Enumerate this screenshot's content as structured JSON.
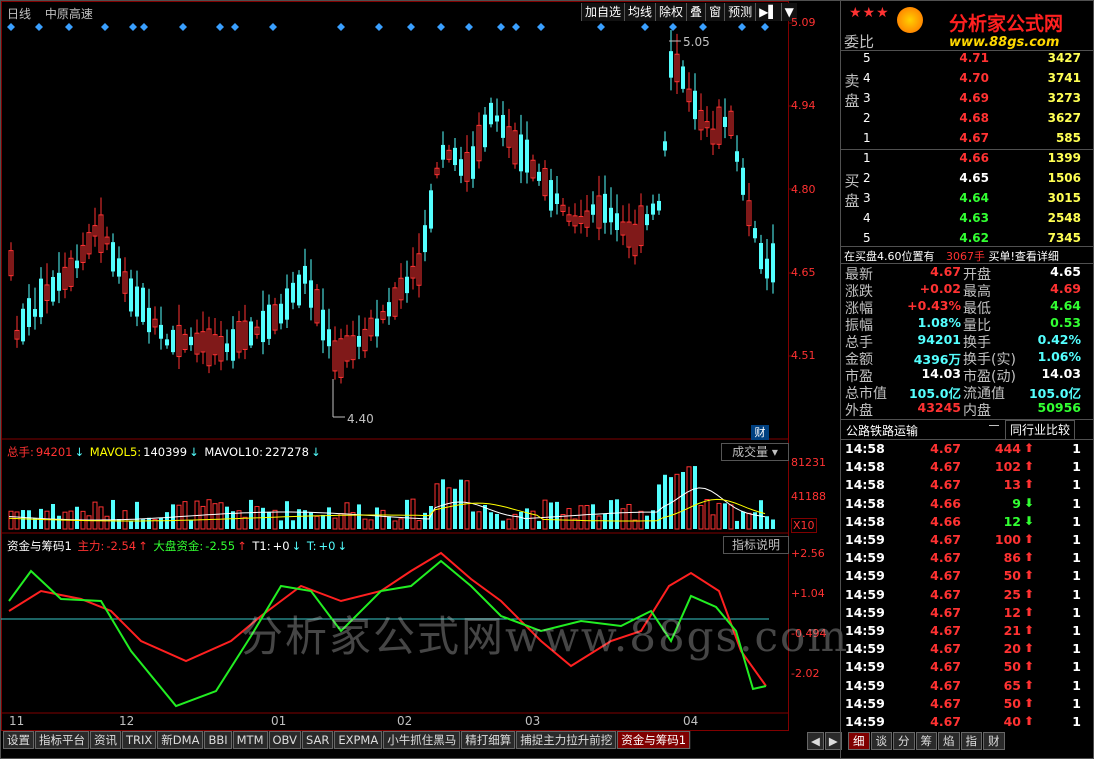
{
  "header": {
    "period": "日线",
    "stock_name": "中原高速"
  },
  "toolbar": [
    "加自选",
    "均线",
    "除权",
    "叠",
    "窗",
    "预测"
  ],
  "toolbar_icons": [
    "arrow-right-icon",
    "dropdown-icon"
  ],
  "price_axis": [
    "5.09",
    "4.94",
    "4.80",
    "4.65",
    "4.51"
  ],
  "price_annotations": {
    "high": "5.05",
    "low": "4.40"
  },
  "finance_badge": "财",
  "volume": {
    "label": "总手:",
    "value": "94201",
    "ma5_label": "MAVOL5:",
    "ma5": "140399",
    "ma10_label": "MAVOL10:",
    "ma10": "227278",
    "axis": [
      "81231",
      "41188"
    ],
    "unit": "X10",
    "dropdown": "成交量"
  },
  "indicator": {
    "name": "资金与筹码1",
    "main_label": "主力:",
    "main": "-2.54",
    "market_label": "大盘资金:",
    "market": "-2.55",
    "t1_label": "T1:",
    "t1": "+0",
    "t_label": "T:",
    "t": "+0",
    "button": "指标说明",
    "axis": [
      "+2.56",
      "+1.04",
      "-0.494",
      "-2.02"
    ]
  },
  "x_axis": [
    "11",
    "12",
    "01",
    "02",
    "03",
    "04"
  ],
  "watermark": "分析家公式网www.88gs.com",
  "bottom_tabs": [
    "设置",
    "指标平台",
    "资讯",
    "TRIX",
    "新DMA",
    "BBI",
    "MTM",
    "OBV",
    "SAR",
    "EXPMA",
    "小牛抓住黑马",
    "精打细算",
    "捕捉主力拉升前挖",
    "资金与筹码1"
  ],
  "bottom_tabs_active": 13,
  "logo": {
    "title": "分析家公式网",
    "url": "www.88gs.com"
  },
  "order_book": {
    "header": "委比",
    "sell_label": "卖盘",
    "buy_label": "买盘",
    "sell": [
      [
        "5",
        "4.71",
        "3427"
      ],
      [
        "4",
        "4.70",
        "3741"
      ],
      [
        "3",
        "4.69",
        "3273"
      ],
      [
        "2",
        "4.68",
        "3627"
      ],
      [
        "1",
        "4.67",
        "585"
      ]
    ],
    "buy": [
      [
        "1",
        "4.66",
        "1399"
      ],
      [
        "2",
        "4.65",
        "1506"
      ],
      [
        "3",
        "4.64",
        "3015"
      ],
      [
        "4",
        "4.63",
        "2548"
      ],
      [
        "5",
        "4.62",
        "7345"
      ]
    ],
    "notice": "在买盘4.60位置有",
    "notice_qty": "3067手",
    "notice_link": "买单!查看详细"
  },
  "quote": [
    [
      "最新",
      "4.67",
      "开盘",
      "4.65"
    ],
    [
      "涨跌",
      "+0.02",
      "最高",
      "4.69"
    ],
    [
      "涨幅",
      "+0.43%",
      "最低",
      "4.64"
    ],
    [
      "振幅",
      "1.08%",
      "量比",
      "0.53"
    ],
    [
      "总手",
      "94201",
      "换手",
      "0.42%"
    ],
    [
      "金额",
      "4396万",
      "换手(实)",
      "1.06%"
    ],
    [
      "市盈",
      "14.03",
      "市盈(动)",
      "14.03"
    ],
    [
      "总市值",
      "105.0亿",
      "流通值",
      "105.0亿"
    ],
    [
      "外盘",
      "43245",
      "内盘",
      "50956"
    ]
  ],
  "industry": {
    "name": "公路铁路运输",
    "button": "同行业比较"
  },
  "ticks": [
    [
      "14:58",
      "4.67",
      "444",
      "up",
      "1"
    ],
    [
      "14:58",
      "4.67",
      "102",
      "up",
      "1"
    ],
    [
      "14:58",
      "4.67",
      "13",
      "up",
      "1"
    ],
    [
      "14:58",
      "4.66",
      "9",
      "down",
      "1"
    ],
    [
      "14:58",
      "4.66",
      "12",
      "down",
      "1"
    ],
    [
      "14:59",
      "4.67",
      "100",
      "up",
      "1"
    ],
    [
      "14:59",
      "4.67",
      "86",
      "up",
      "1"
    ],
    [
      "14:59",
      "4.67",
      "50",
      "up",
      "1"
    ],
    [
      "14:59",
      "4.67",
      "25",
      "up",
      "1"
    ],
    [
      "14:59",
      "4.67",
      "12",
      "up",
      "1"
    ],
    [
      "14:59",
      "4.67",
      "21",
      "up",
      "1"
    ],
    [
      "14:59",
      "4.67",
      "20",
      "up",
      "1"
    ],
    [
      "14:59",
      "4.67",
      "50",
      "up",
      "1"
    ],
    [
      "14:59",
      "4.67",
      "65",
      "up",
      "1"
    ],
    [
      "14:59",
      "4.67",
      "50",
      "up",
      "1"
    ],
    [
      "14:59",
      "4.67",
      "40",
      "up",
      "1"
    ]
  ],
  "right_tabs": [
    "细",
    "谈",
    "分",
    "筹",
    "焰",
    "指",
    "财"
  ],
  "right_tabs_active": 0,
  "colors": {
    "up": "#ff3232",
    "down": "#54ffff",
    "green": "#32ff32",
    "bg": "#000000",
    "grid": "#800000"
  }
}
